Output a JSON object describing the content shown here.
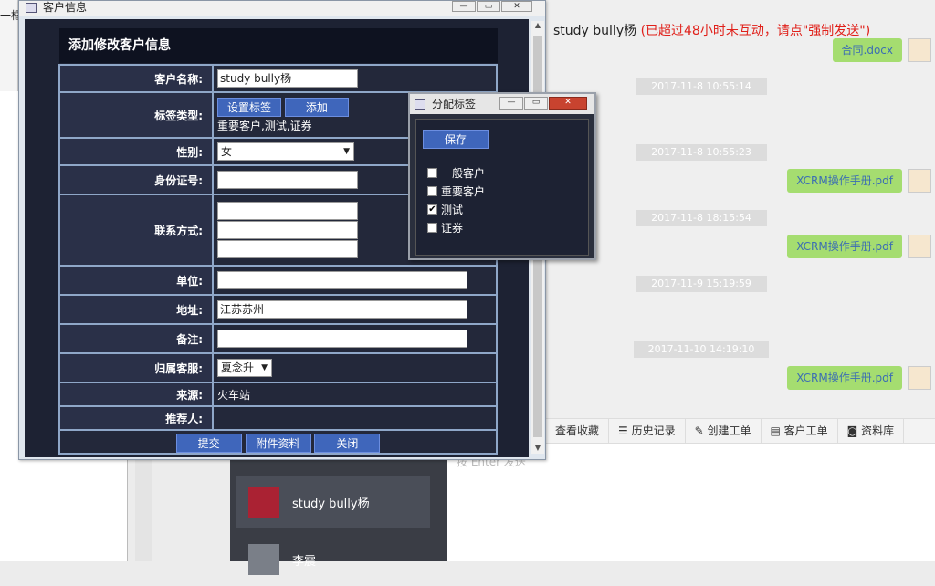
{
  "background": {
    "left_label": "一框",
    "contacts": [
      {
        "name": "study bully杨"
      },
      {
        "name": "李震"
      }
    ],
    "chat_header": "study bully杨",
    "chat_warning": "(已超过48小时未互动，请点\"强制发送\")",
    "messages": [
      {
        "kind": "file",
        "text": "合同.docx"
      },
      {
        "kind": "time",
        "text": "2017-11-8 10:55:14"
      },
      {
        "kind": "time",
        "text": "2017-11-8 10:55:23"
      },
      {
        "kind": "file",
        "text": "XCRM操作手册.pdf"
      },
      {
        "kind": "time",
        "text": "2017-11-8 18:15:54"
      },
      {
        "kind": "file",
        "text": "XCRM操作手册.pdf"
      },
      {
        "kind": "time",
        "text": "2017-11-9 15:19:59"
      },
      {
        "kind": "time",
        "text": "2017-11-10 14:19:10"
      },
      {
        "kind": "file",
        "text": "XCRM操作手册.pdf"
      }
    ],
    "toolbar": [
      "查看收藏",
      "历史记录",
      "创建工单",
      "客户工单",
      "资料库"
    ],
    "footer_hint": "按 Enter 发送"
  },
  "customer_dialog": {
    "title": "客户信息",
    "heading": "添加修改客户信息",
    "fields": {
      "name": {
        "label": "客户名称:",
        "value": "study bully杨"
      },
      "tags": {
        "label": "标签类型:",
        "set_button": "设置标签",
        "add_button": "添加",
        "value": "重要客户,测试,证券"
      },
      "gender": {
        "label": "性别:",
        "value": "女"
      },
      "id_card": {
        "label": "身份证号:",
        "value": ""
      },
      "contact": {
        "label": "联系方式:",
        "values": [
          "",
          "",
          ""
        ]
      },
      "company": {
        "label": "单位:",
        "value": ""
      },
      "address": {
        "label": "地址:",
        "value": "江苏苏州"
      },
      "remark": {
        "label": "备注:",
        "value": ""
      },
      "owner": {
        "label": "归属客服:",
        "value": "夏念升"
      },
      "source": {
        "label": "来源:",
        "value": "火车站"
      },
      "referrer": {
        "label": "推荐人:",
        "value": ""
      }
    },
    "buttons": {
      "submit": "提交",
      "attach": "附件资料",
      "close": "关闭"
    }
  },
  "tag_dialog": {
    "title": "分配标签",
    "save": "保存",
    "options": [
      {
        "label": "一般客户",
        "checked": false
      },
      {
        "label": "重要客户",
        "checked": false
      },
      {
        "label": "测试",
        "checked": true
      },
      {
        "label": "证券",
        "checked": false
      }
    ]
  }
}
